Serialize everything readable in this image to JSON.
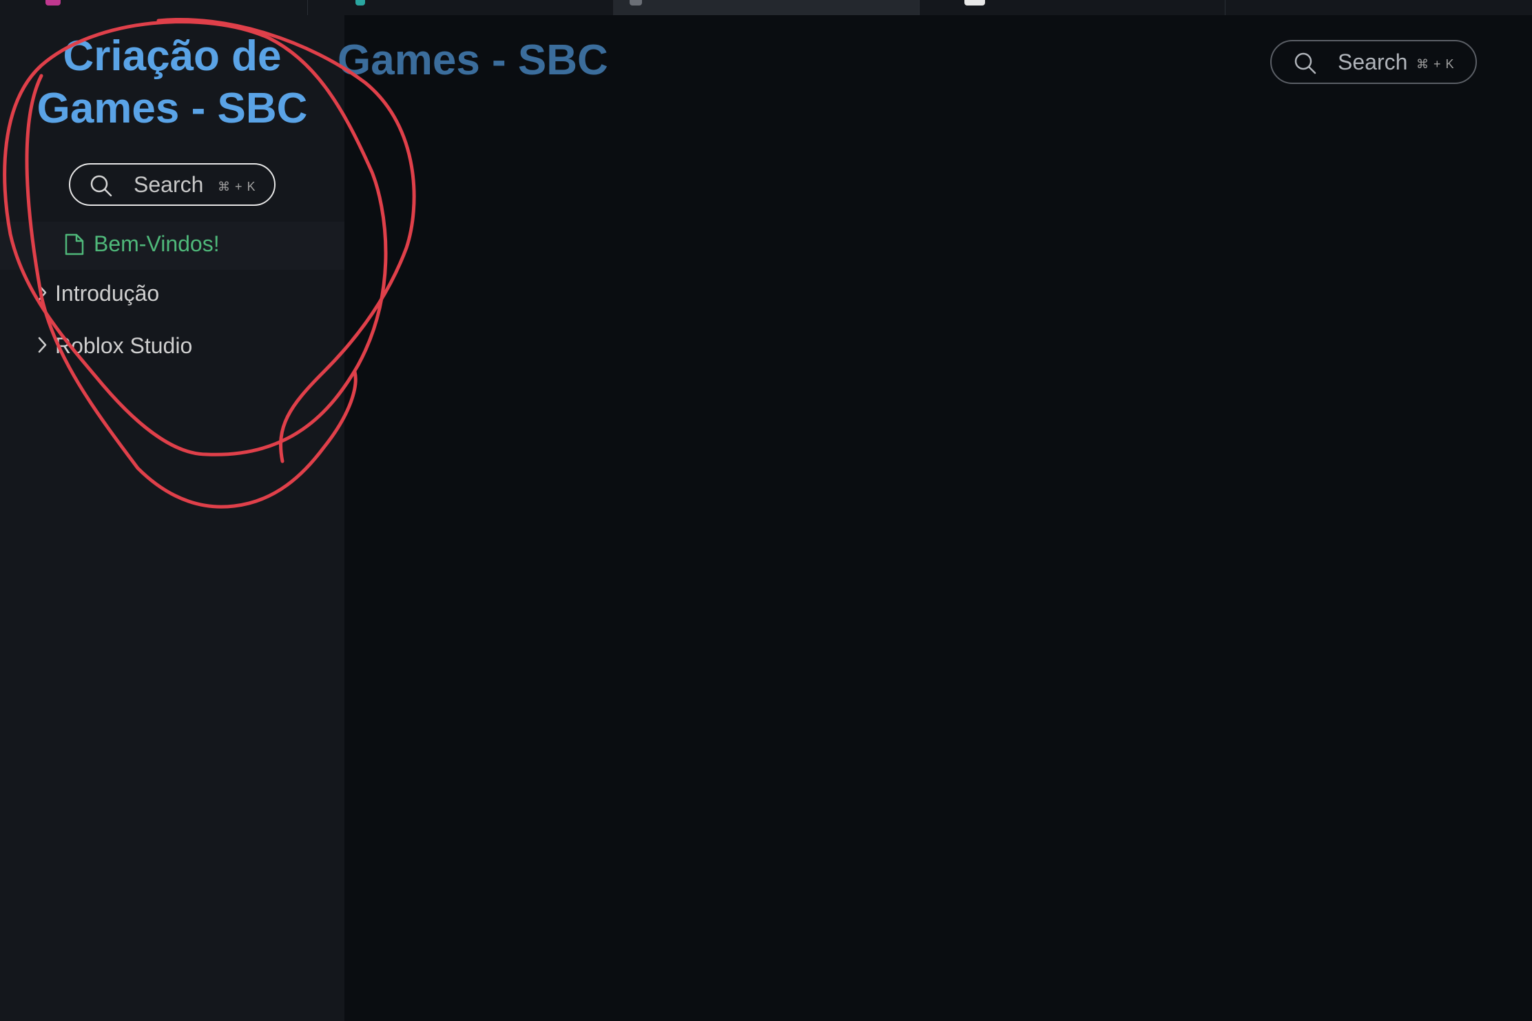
{
  "app": {
    "site_title": "Criação de Games - SBC",
    "site_title_line1": "Criação de",
    "site_title_line2": "Games - SBC",
    "header_title_visible": "Games - SBC"
  },
  "sidebar": {
    "search": {
      "label": "Search",
      "shortcut": "⌘ + K"
    },
    "items": [
      {
        "label": "Bem-Vindos!",
        "icon": "page-icon",
        "active": true
      },
      {
        "label": "Introdução",
        "icon": "chevron-right-icon",
        "active": false
      },
      {
        "label": "Roblox Studio",
        "icon": "chevron-right-icon",
        "active": false
      }
    ]
  },
  "header": {
    "search": {
      "label": "Search",
      "shortcut": "⌘ + K"
    }
  },
  "colors": {
    "background": "#0a0d11",
    "sidebar": "#14171c",
    "title_blue": "#5aa3e6",
    "active_green": "#4fb87a",
    "annotation_red": "#e0404a"
  }
}
